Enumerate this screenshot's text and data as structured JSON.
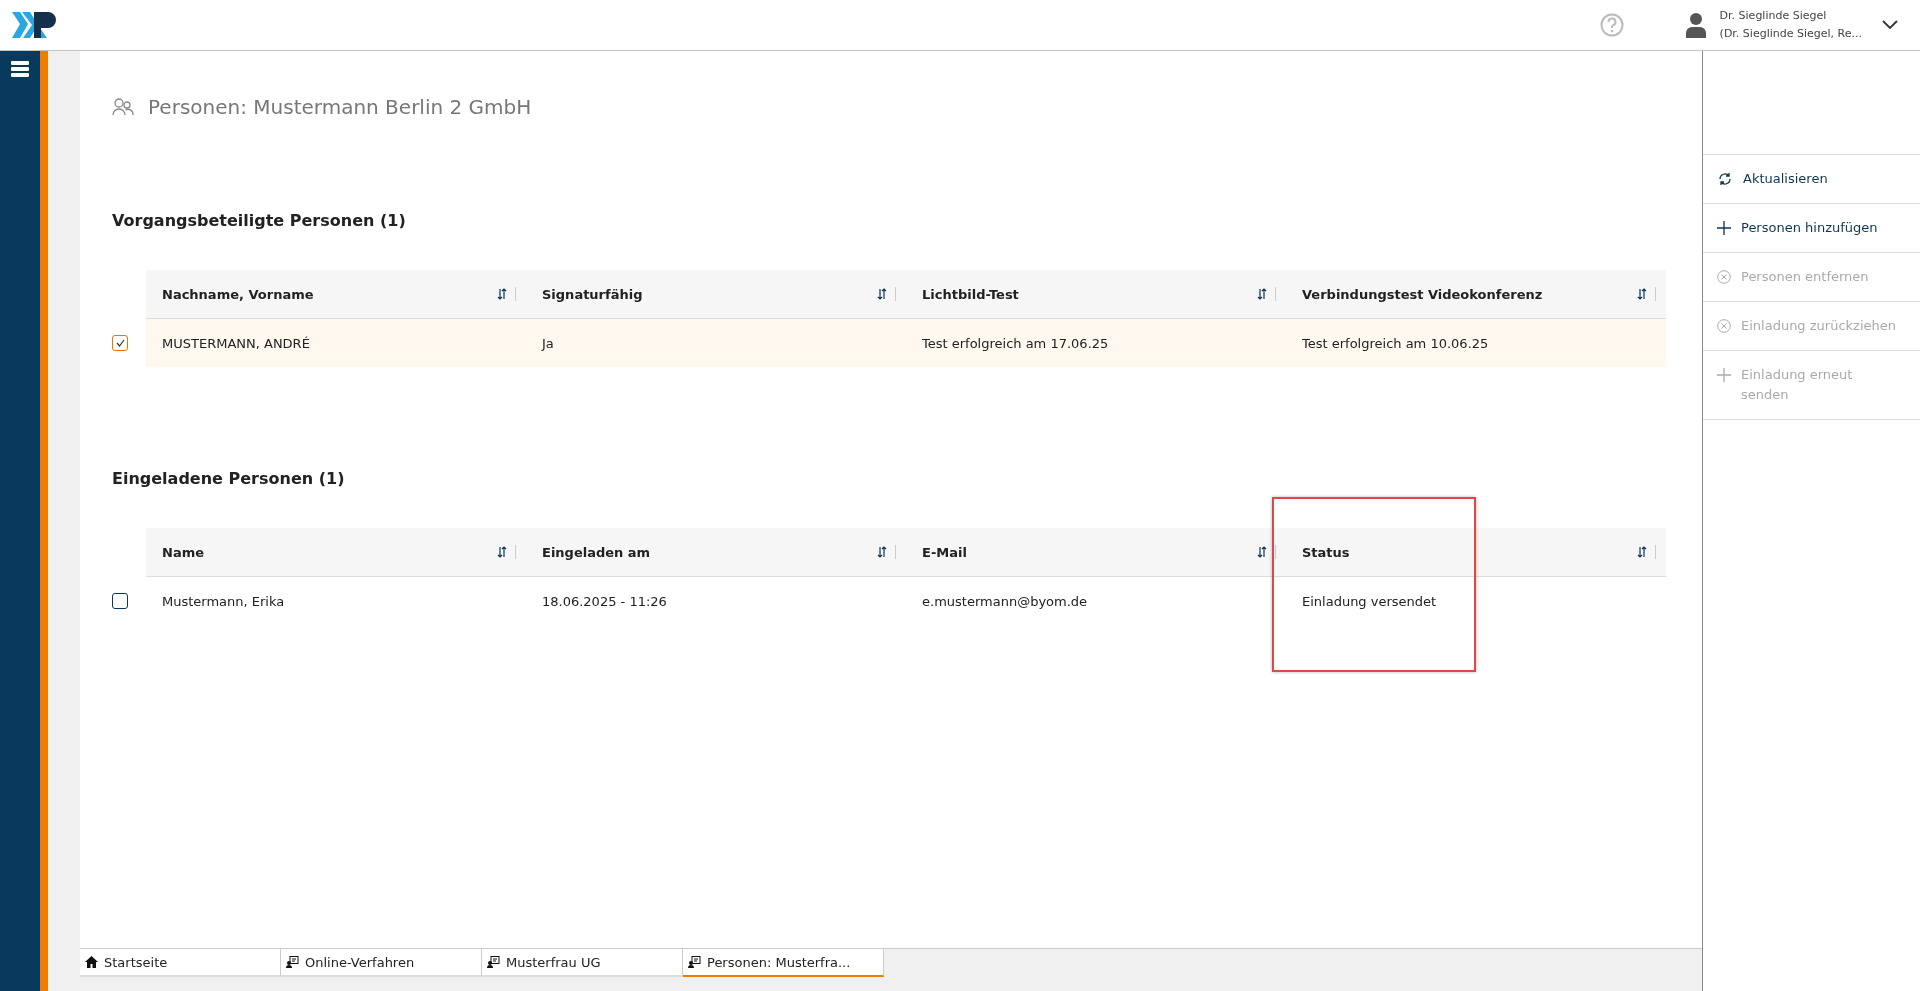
{
  "header": {
    "user_name": "Dr. Sieglinde Siegel",
    "user_role": "(Dr. Sieglinde Siegel, Re..."
  },
  "page_title": "Personen: Mustermann Berlin 2 GmbH",
  "sections": [
    {
      "title": "Vorgangsbeteiligte Personen (1)",
      "columns": [
        {
          "label": "Nachname, Vorname",
          "highlighted": false
        },
        {
          "label": "Signaturfähig",
          "highlighted": false
        },
        {
          "label": "Lichtbild-Test",
          "highlighted": false
        },
        {
          "label": "Verbindungstest Videokonferenz",
          "highlighted": false
        }
      ],
      "rows": [
        {
          "checked": true,
          "cells": [
            "MUSTERMANN, ANDRÉ",
            "Ja",
            "Test erfolgreich am 17.06.25",
            "Test erfolgreich am 10.06.25"
          ]
        }
      ]
    },
    {
      "title": "Eingeladene Personen (1)",
      "columns": [
        {
          "label": "Name",
          "highlighted": false
        },
        {
          "label": "Eingeladen am",
          "highlighted": false
        },
        {
          "label": "E-Mail",
          "highlighted": false
        },
        {
          "label": "Status",
          "highlighted": true
        }
      ],
      "rows": [
        {
          "checked": false,
          "cells": [
            "Mustermann, Erika",
            "18.06.2025 - 11:26",
            "e.mustermann@byom.de",
            "Einladung versendet"
          ]
        }
      ]
    }
  ],
  "actions": [
    {
      "kind": "refresh",
      "label": "Aktualisieren",
      "disabled": false
    },
    {
      "kind": "add",
      "label": "Personen hinzufügen",
      "disabled": false
    },
    {
      "kind": "remove",
      "label": "Personen entfernen",
      "disabled": true
    },
    {
      "kind": "remove",
      "label": "Einladung zurückziehen",
      "disabled": true
    },
    {
      "kind": "add",
      "label": "Einladung erneut senden",
      "disabled": true
    }
  ],
  "tabs": [
    {
      "kind": "home",
      "label": "Startseite",
      "selected": false
    },
    {
      "kind": "doc",
      "label": "Online-Verfahren",
      "selected": false
    },
    {
      "kind": "doc",
      "label": "Musterfrau UG",
      "selected": false
    },
    {
      "kind": "doc",
      "label": "Personen: Musterfra...",
      "selected": true
    }
  ]
}
